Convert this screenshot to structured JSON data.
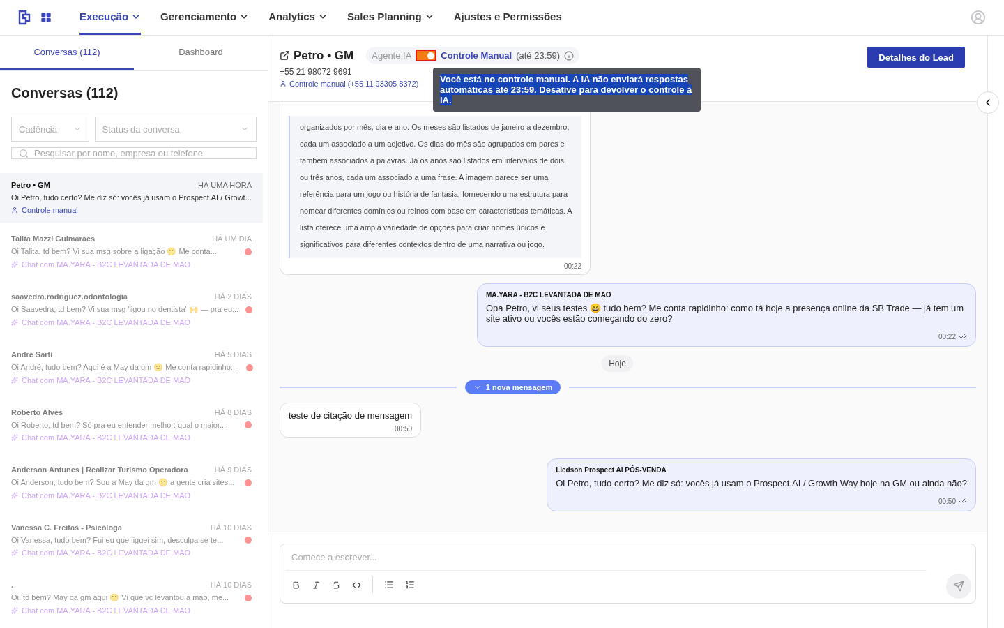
{
  "nav": {
    "items": [
      {
        "label": "Execução",
        "selected": true,
        "dropdown": true
      },
      {
        "label": "Gerenciamento",
        "selected": false,
        "dropdown": true
      },
      {
        "label": "Analytics",
        "selected": false,
        "dropdown": true
      },
      {
        "label": "Sales Planning",
        "selected": false,
        "dropdown": true
      },
      {
        "label": "Ajustes e Permissões",
        "selected": false,
        "dropdown": false
      }
    ]
  },
  "sidebar": {
    "tabs": [
      {
        "label": "Conversas (112)",
        "selected": true
      },
      {
        "label": "Dashboard",
        "selected": false
      }
    ],
    "title": "Conversas (112)",
    "filters": [
      {
        "placeholder": "Cadência"
      },
      {
        "placeholder": "Status da conversa"
      }
    ],
    "search": {
      "placeholder": "Pesquisar por nome, empresa ou telefone"
    },
    "conversations": [
      {
        "name": "Petro • GM",
        "time": "HÁ UMA HORA",
        "preview": "Oi Petro, tudo certo? Me diz só: vocês já usam o Prospect.AI / Growt...",
        "tag": "Controle manual",
        "kind": "manual",
        "selected": true,
        "unread": false
      },
      {
        "name": "Talita Mazzi Guimaraes",
        "time": "HÁ UM DIA",
        "preview": "Oi Talita, td bem? Vi sua msg sobre a ligação 🙂 Me conta...",
        "tag": "Chat com MA.YARA - B2C LEVANTADA DE MAO",
        "kind": "agent",
        "selected": false,
        "unread": true
      },
      {
        "name": "saavedra.rodriguez.odontologia",
        "time": "HÁ 2 DIAS",
        "preview": "Oi Saavedra, td bem? Vi sua msg 'ligou no dentista' 🙌 — pra eu...",
        "tag": "Chat com MA.YARA - B2C LEVANTADA DE MAO",
        "kind": "agent",
        "selected": false,
        "unread": true
      },
      {
        "name": "André Sarti",
        "time": "HÁ 5 DIAS",
        "preview": "Oi André, tudo bem? Aqui é a May da gm 🙂 Me conta rapidinho:...",
        "tag": "Chat com MA.YARA - B2C LEVANTADA DE MAO",
        "kind": "agent",
        "selected": false,
        "unread": true
      },
      {
        "name": "Roberto Alves",
        "time": "HÁ 8 DIAS",
        "preview": "Oi Roberto, td bem? Só pra eu entender melhor: qual o maior...",
        "tag": "Chat com MA.YARA - B2C LEVANTADA DE MAO",
        "kind": "agent",
        "selected": false,
        "unread": true
      },
      {
        "name": "Anderson Antunes | Realizar Turismo Operadora",
        "time": "HÁ 9 DIAS",
        "preview": "Oi Anderson, tudo bem? Sou a May da gm 🙂 a gente cria sites...",
        "tag": "Chat com MA.YARA - B2C LEVANTADA DE MAO",
        "kind": "agent",
        "selected": false,
        "unread": true
      },
      {
        "name": "Vanessa C. Freitas - Psicóloga",
        "time": "HÁ 10 DIAS",
        "preview": "Oi Vanessa, tudo bem? Fui eu que liguei sim, desculpa se te...",
        "tag": "Chat com MA.YARA - B2C LEVANTADA DE MAO",
        "kind": "agent",
        "selected": false,
        "unread": true
      },
      {
        "name": ".",
        "time": "HÁ 10 DIAS",
        "preview": "Oi, td bem? May da gm aqui 🙂 Vi que vc levantou a mão, me...",
        "tag": "Chat com MA.YARA - B2C LEVANTADA DE MAO",
        "kind": "agent",
        "selected": false,
        "unread": true
      }
    ]
  },
  "chat": {
    "contact": "Petro • GM",
    "phone": "+55 21 98072 9691",
    "control_note": "Controle manual (+55 11 93305 8372)",
    "agent_label": "Agente IA",
    "manual_on": true,
    "manual_label": "Controle Manual",
    "manual_until": "(até 23:59)",
    "tooltip": {
      "text": "Você está no controle manual. A IA não enviará respostas automáticas até 23:59. Desative para devolver o controle à IA.",
      "text_selected": true
    },
    "lead_button": "Detalhes do Lead",
    "messages": [
      {
        "kind": "quote",
        "text": "organizados por mês, dia e ano. Os meses são listados de janeiro a dezembro, cada um associado a um adjetivo. Os dias do mês são agrupados em pares e também associados a palavras. Já os anos são listados em intervalos de dois ou três anos, cada um associado a uma frase. A imagem parece ser uma referência para um jogo ou história de fantasia, fornecendo uma estrutura para nomear diferentes domínios ou reinos com base em características temáticas. A lista oferece uma ampla variedade de opções para criar nomes únicos e significativos para diferentes contextos dentro de uma narrativa ou jogo.",
        "time": "00:22"
      },
      {
        "kind": "outgoing",
        "sender": "MA.YARA - B2C LEVANTADA DE MAO",
        "text": "Opa Petro, vi seus testes 😄 tudo bem? Me conta rapidinho: como tá hoje a presença online da SB Trade — já tem um site ativo ou vocês estão começando do zero?",
        "time": "00:22",
        "read": true
      },
      {
        "kind": "date",
        "text": "Hoje"
      },
      {
        "kind": "new",
        "text": "1 nova mensagem"
      },
      {
        "kind": "incoming",
        "text": "teste de citação de mensagem",
        "time": "00:50"
      },
      {
        "kind": "outgoing",
        "sender": "Liedson Prospect AI PÓS-VENDA",
        "text": "Oi Petro, tudo certo? Me diz só: vocês já usam o Prospect.AI / Growth Way hoje na GM ou ainda não?",
        "time": "00:50",
        "read": true
      }
    ],
    "composer": {
      "placeholder": "Comece a escrever..."
    }
  }
}
